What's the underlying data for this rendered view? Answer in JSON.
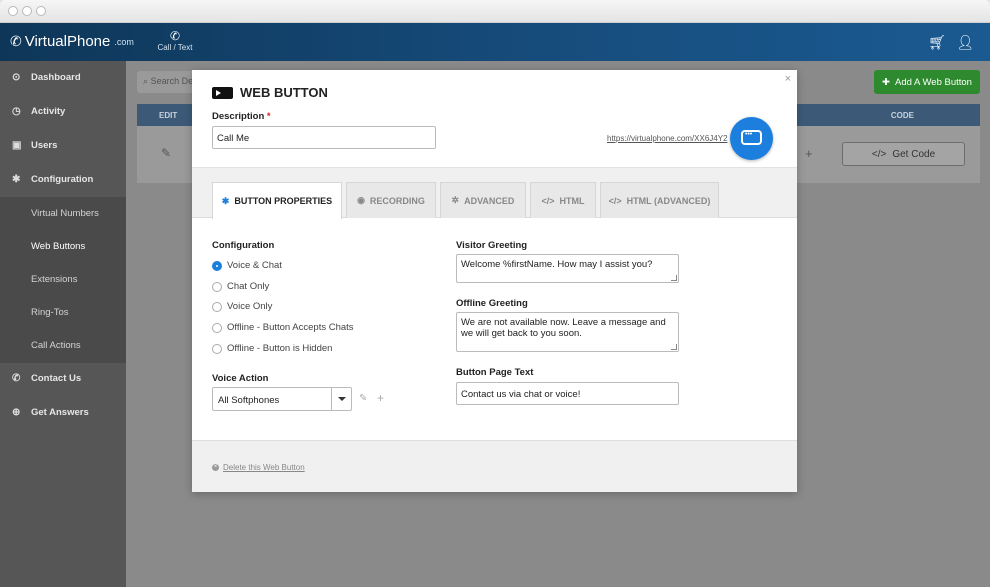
{
  "topbar": {
    "logo_part1": "VirtualPhone",
    "logo_part2": ".com",
    "call_text_label": "Call / Text"
  },
  "sidebar": {
    "items": [
      {
        "label": "Dashboard",
        "icon": "dashboard-icon"
      },
      {
        "label": "Activity",
        "icon": "clock-icon"
      },
      {
        "label": "Users",
        "icon": "users-icon"
      },
      {
        "label": "Configuration",
        "icon": "gear-icon"
      }
    ],
    "subitems": [
      {
        "label": "Virtual Numbers"
      },
      {
        "label": "Web Buttons"
      },
      {
        "label": "Extensions"
      },
      {
        "label": "Ring-Tos"
      },
      {
        "label": "Call Actions"
      }
    ],
    "bottom_items": [
      {
        "label": "Contact Us",
        "icon": "phone-icon"
      },
      {
        "label": "Get Answers",
        "icon": "globe-icon"
      }
    ]
  },
  "main": {
    "search_placeholder": "Search De",
    "add_button_label": "Add A Web Button",
    "table": {
      "col_edit": "EDIT",
      "col_code": "CODE",
      "get_code_label": "Get Code"
    }
  },
  "modal": {
    "title": "WEB BUTTON",
    "description_label": "Description",
    "required_mark": "*",
    "description_value": "Call Me",
    "button_url": "https://virtualphone.com/XX6J4Y2",
    "tabs": [
      {
        "label": "BUTTON PROPERTIES",
        "icon": "gear-icon",
        "active": true
      },
      {
        "label": "RECORDING",
        "icon": "record-icon",
        "active": false
      },
      {
        "label": "ADVANCED",
        "icon": "gears-icon",
        "active": false
      },
      {
        "label": "HTML",
        "icon": "code-icon",
        "active": false
      },
      {
        "label": "HTML (ADVANCED)",
        "icon": "code-icon",
        "active": false
      }
    ],
    "configuration": {
      "label": "Configuration",
      "options": [
        {
          "label": "Voice & Chat",
          "checked": true
        },
        {
          "label": "Chat Only",
          "checked": false
        },
        {
          "label": "Voice Only",
          "checked": false
        },
        {
          "label": "Offline - Button Accepts Chats",
          "checked": false
        },
        {
          "label": "Offline - Button is Hidden",
          "checked": false
        }
      ]
    },
    "voice_action": {
      "label": "Voice Action",
      "selected": "All Softphones"
    },
    "visitor_greeting": {
      "label": "Visitor Greeting",
      "value": "Welcome %firstName. How may I assist you?"
    },
    "offline_greeting": {
      "label": "Offline Greeting",
      "value": "We are not available now. Leave a message and we will get back to you soon."
    },
    "button_page_text": {
      "label": "Button Page Text",
      "value": "Contact us via chat or voice!"
    },
    "delete_label": "Delete this Web Button",
    "accent_color": "#1c7fde"
  }
}
